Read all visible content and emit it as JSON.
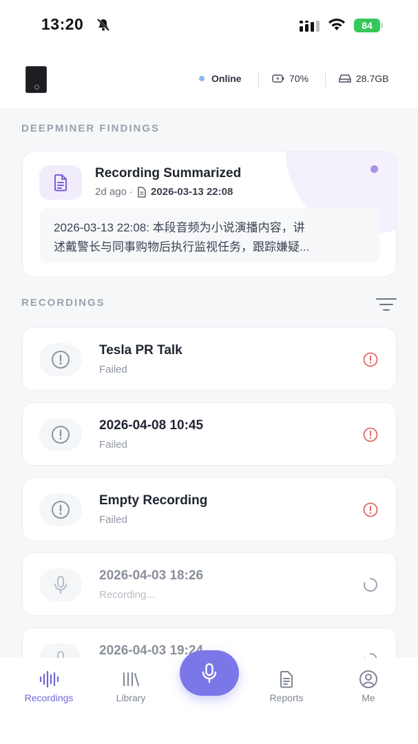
{
  "status_bar": {
    "time": "13:20",
    "battery": "84"
  },
  "device": {
    "online_label": "Online",
    "battery_level": "70%",
    "storage": "28.7GB"
  },
  "findings": {
    "section_title": "DEEPMINER FINDINGS",
    "card": {
      "title": "Recording Summarized",
      "age": "2d ago ·",
      "date": "2026-03-13 22:08",
      "summary_line1": "2026-03-13 22:08: 本段音频为小说演播内容，讲",
      "summary_line2": "述戴警长与同事购物后执行监视任务，跟踪嫌疑..."
    }
  },
  "recordings": {
    "section_title": "RECORDINGS",
    "items": [
      {
        "title": "Tesla PR Talk",
        "status": "Failed",
        "icon": "alert-circle-icon",
        "action_icon": "error-icon"
      },
      {
        "title": "2026-04-08 10:45",
        "status": "Failed",
        "icon": "alert-circle-icon",
        "action_icon": "error-icon"
      },
      {
        "title": "Empty Recording",
        "status": "Failed",
        "icon": "alert-circle-icon",
        "action_icon": "error-icon"
      },
      {
        "title": "2026-04-03 18:26",
        "status": "Recording...",
        "icon": "mic-icon",
        "action_icon": "spinner-icon"
      },
      {
        "title": "2026-04-03 19:24",
        "status": "",
        "icon": "mic-icon",
        "action_icon": "spinner-icon"
      }
    ]
  },
  "nav": {
    "recordings": "Recordings",
    "library": "Library",
    "reports": "Reports",
    "me": "Me"
  },
  "colors": {
    "accent": "#7c77e8",
    "error": "#e06666",
    "online": "#8fb8ef",
    "battery_green": "#34c759"
  }
}
